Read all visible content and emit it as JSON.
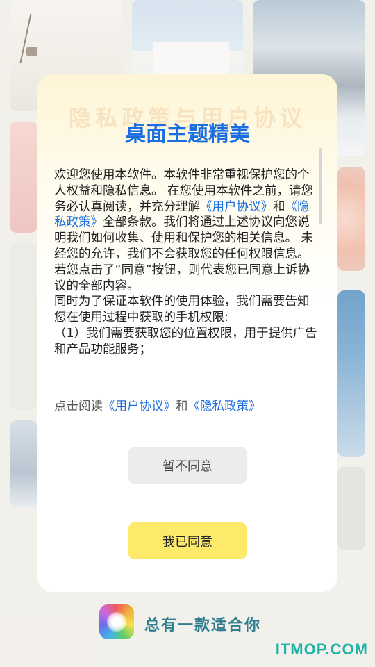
{
  "background": {
    "slogan": "总有一款适合你",
    "watermark": "ITMOP.COM"
  },
  "dialog": {
    "ghost_title": "隐私政策与用户协议",
    "title": "桌面主题精美",
    "body": {
      "p1_a": "欢迎您使用本软件。本软件非常重视保护您的个人权益和隐私信息。 在您使用本软件之前，请您务必认真阅读，并充分理解",
      "link_user_agreement": "《用户协议》",
      "and": "和",
      "link_privacy_policy": "《隐私政策》",
      "p1_b": "全部条款。我们将通过上述协议向您说明我们如何收集、使用和保护您的相关信息。 未经您的允许，我们不会获取您的任何权限信息。若您点击了“同意”按钮，则代表您已同意上诉协议的全部内容。",
      "p2": " 同时为了保证本软件的使用体验，我们需要告知您在使用过程中获取的手机权限:",
      "p3": "（1）我们需要获取您的位置权限，用于提供广告和产品功能服务；"
    },
    "read_prefix": "点击阅读",
    "read_link_user": "《用户协议》",
    "read_and": "和",
    "read_link_privacy": "《隐私政策》",
    "decline_label": "暂不同意",
    "agree_label": "我已同意"
  },
  "colors": {
    "accent": "#1a6ee0",
    "agree_button": "#fde96a",
    "decline_button": "#ececec"
  }
}
